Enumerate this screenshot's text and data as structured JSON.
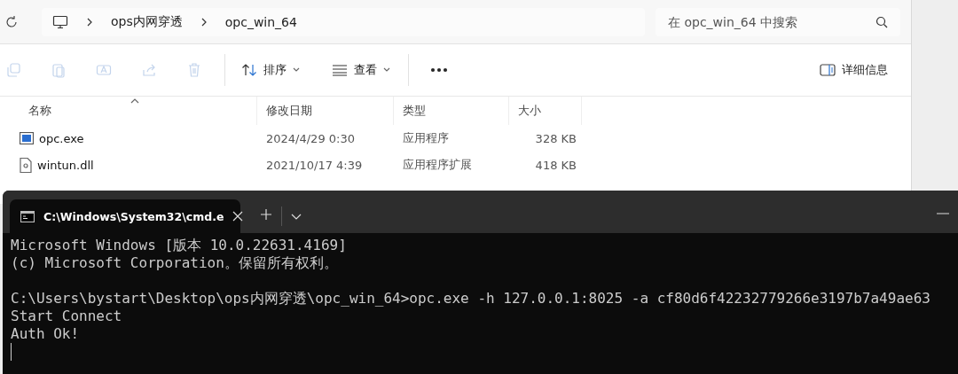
{
  "explorer": {
    "breadcrumb": [
      "ops内网穿透",
      "opc_win_64"
    ],
    "search": {
      "placeholder": "在 opc_win_64 中搜索"
    },
    "toolbar": {
      "icon_buttons": [
        {
          "disabled": true
        },
        {
          "disabled": true
        },
        {
          "disabled": true
        },
        {
          "disabled": true
        },
        {
          "disabled": true
        }
      ],
      "sort": "排序",
      "view": "查看",
      "details": "详细信息"
    },
    "columns": [
      {
        "label": "名称",
        "sorted": true
      },
      {
        "label": "修改日期",
        "sorted": false
      },
      {
        "label": "类型",
        "sorted": false
      },
      {
        "label": "大小",
        "sorted": false
      }
    ],
    "rows": [
      {
        "kind": "exe",
        "name": "opc.exe",
        "modified": "2024/4/29 0:30",
        "type": "应用程序",
        "size": "328 KB"
      },
      {
        "kind": "dll",
        "name": "wintun.dll",
        "modified": "2021/10/17 4:39",
        "type": "应用程序扩展",
        "size": "418 KB"
      }
    ]
  },
  "terminal": {
    "tab": {
      "title": "C:\\Windows\\System32\\cmd.e",
      "selected": true
    },
    "lines": [
      {
        "kind": "text",
        "text": "Microsoft Windows [版本 10.0.22631.4169]"
      },
      {
        "kind": "text",
        "text": "(c) Microsoft Corporation。保留所有权利。"
      },
      {
        "kind": "blank"
      },
      {
        "kind": "text",
        "text": "C:\\Users\\bystart\\Desktop\\ops内网穿透\\opc_win_64>opc.exe -h 127.0.0.1:8025 -a cf80d6f42232779266e3197b7a49ae63"
      },
      {
        "kind": "text",
        "text": "Start Connect"
      },
      {
        "kind": "text",
        "text": "Auth Ok!"
      }
    ]
  }
}
